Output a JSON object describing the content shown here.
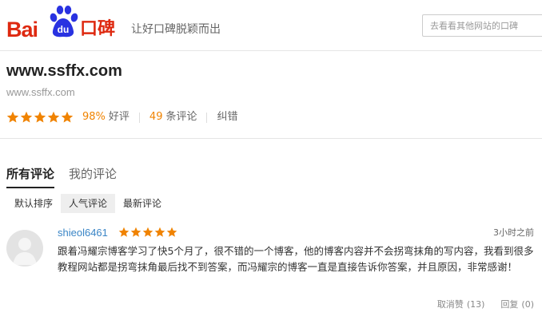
{
  "header": {
    "logo_left": "Bai",
    "logo_paw_text": "du",
    "logo_right": "口碑",
    "slogan": "让好口碑脱颖而出",
    "search_placeholder": "去看看其他网站的口碑"
  },
  "site": {
    "title": "www.ssffx.com",
    "url": "www.ssffx.com",
    "rating_stars": 5,
    "positive_rate": "98%",
    "positive_label": "好评",
    "review_count": "49",
    "review_label": "条评论",
    "report_label": "纠错"
  },
  "reviews": {
    "tabs": [
      "所有评论",
      "我的评论"
    ],
    "sort_options": [
      "默认排序",
      "人气评论",
      "最新评论"
    ],
    "items": [
      {
        "user": "shieol6461",
        "stars": 5,
        "time": "3小时之前",
        "content": "跟着冯耀宗博客学习了快5个月了，很不错的一个博客，他的博客内容并不会拐弯抹角的写内容，我看到很多教程网站都是拐弯抹角最后找不到答案，而冯耀宗的博客一直是直接告诉你答案，并且原因，非常感谢！",
        "cancel_like_label": "取消赞",
        "cancel_like_count": "(13)",
        "reply_label": "回复",
        "reply_count": "(0)"
      }
    ]
  },
  "colors": {
    "brand_red": "#de2910",
    "paw_blue": "#2932e1",
    "star_orange": "#f08300",
    "link_blue": "#3a85c6"
  },
  "icons": [
    "baidu-paw-icon",
    "star-icon",
    "avatar-placeholder-icon"
  ]
}
